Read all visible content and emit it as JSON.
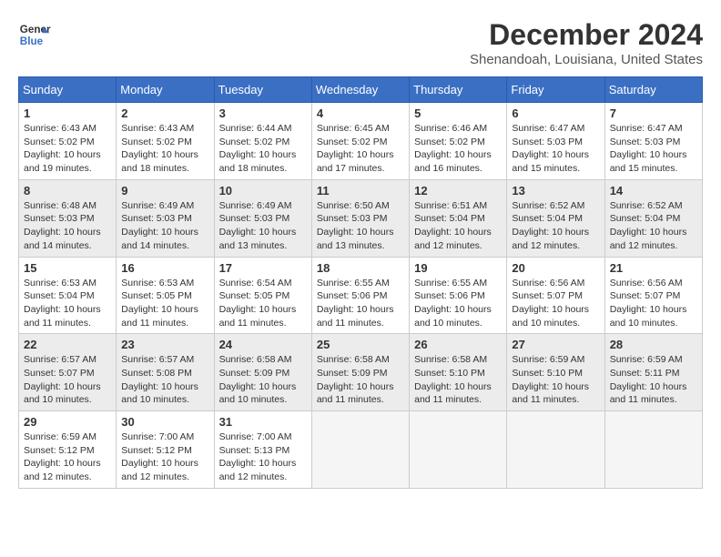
{
  "header": {
    "logo_line1": "General",
    "logo_line2": "Blue",
    "month": "December 2024",
    "location": "Shenandoah, Louisiana, United States"
  },
  "weekdays": [
    "Sunday",
    "Monday",
    "Tuesday",
    "Wednesday",
    "Thursday",
    "Friday",
    "Saturday"
  ],
  "weeks": [
    [
      {
        "day": "1",
        "sunrise": "6:43 AM",
        "sunset": "5:02 PM",
        "daylight": "10 hours and 19 minutes."
      },
      {
        "day": "2",
        "sunrise": "6:43 AM",
        "sunset": "5:02 PM",
        "daylight": "10 hours and 18 minutes."
      },
      {
        "day": "3",
        "sunrise": "6:44 AM",
        "sunset": "5:02 PM",
        "daylight": "10 hours and 18 minutes."
      },
      {
        "day": "4",
        "sunrise": "6:45 AM",
        "sunset": "5:02 PM",
        "daylight": "10 hours and 17 minutes."
      },
      {
        "day": "5",
        "sunrise": "6:46 AM",
        "sunset": "5:02 PM",
        "daylight": "10 hours and 16 minutes."
      },
      {
        "day": "6",
        "sunrise": "6:47 AM",
        "sunset": "5:03 PM",
        "daylight": "10 hours and 15 minutes."
      },
      {
        "day": "7",
        "sunrise": "6:47 AM",
        "sunset": "5:03 PM",
        "daylight": "10 hours and 15 minutes."
      }
    ],
    [
      {
        "day": "8",
        "sunrise": "6:48 AM",
        "sunset": "5:03 PM",
        "daylight": "10 hours and 14 minutes."
      },
      {
        "day": "9",
        "sunrise": "6:49 AM",
        "sunset": "5:03 PM",
        "daylight": "10 hours and 14 minutes."
      },
      {
        "day": "10",
        "sunrise": "6:49 AM",
        "sunset": "5:03 PM",
        "daylight": "10 hours and 13 minutes."
      },
      {
        "day": "11",
        "sunrise": "6:50 AM",
        "sunset": "5:03 PM",
        "daylight": "10 hours and 13 minutes."
      },
      {
        "day": "12",
        "sunrise": "6:51 AM",
        "sunset": "5:04 PM",
        "daylight": "10 hours and 12 minutes."
      },
      {
        "day": "13",
        "sunrise": "6:52 AM",
        "sunset": "5:04 PM",
        "daylight": "10 hours and 12 minutes."
      },
      {
        "day": "14",
        "sunrise": "6:52 AM",
        "sunset": "5:04 PM",
        "daylight": "10 hours and 12 minutes."
      }
    ],
    [
      {
        "day": "15",
        "sunrise": "6:53 AM",
        "sunset": "5:04 PM",
        "daylight": "10 hours and 11 minutes."
      },
      {
        "day": "16",
        "sunrise": "6:53 AM",
        "sunset": "5:05 PM",
        "daylight": "10 hours and 11 minutes."
      },
      {
        "day": "17",
        "sunrise": "6:54 AM",
        "sunset": "5:05 PM",
        "daylight": "10 hours and 11 minutes."
      },
      {
        "day": "18",
        "sunrise": "6:55 AM",
        "sunset": "5:06 PM",
        "daylight": "10 hours and 11 minutes."
      },
      {
        "day": "19",
        "sunrise": "6:55 AM",
        "sunset": "5:06 PM",
        "daylight": "10 hours and 10 minutes."
      },
      {
        "day": "20",
        "sunrise": "6:56 AM",
        "sunset": "5:07 PM",
        "daylight": "10 hours and 10 minutes."
      },
      {
        "day": "21",
        "sunrise": "6:56 AM",
        "sunset": "5:07 PM",
        "daylight": "10 hours and 10 minutes."
      }
    ],
    [
      {
        "day": "22",
        "sunrise": "6:57 AM",
        "sunset": "5:07 PM",
        "daylight": "10 hours and 10 minutes."
      },
      {
        "day": "23",
        "sunrise": "6:57 AM",
        "sunset": "5:08 PM",
        "daylight": "10 hours and 10 minutes."
      },
      {
        "day": "24",
        "sunrise": "6:58 AM",
        "sunset": "5:09 PM",
        "daylight": "10 hours and 10 minutes."
      },
      {
        "day": "25",
        "sunrise": "6:58 AM",
        "sunset": "5:09 PM",
        "daylight": "10 hours and 11 minutes."
      },
      {
        "day": "26",
        "sunrise": "6:58 AM",
        "sunset": "5:10 PM",
        "daylight": "10 hours and 11 minutes."
      },
      {
        "day": "27",
        "sunrise": "6:59 AM",
        "sunset": "5:10 PM",
        "daylight": "10 hours and 11 minutes."
      },
      {
        "day": "28",
        "sunrise": "6:59 AM",
        "sunset": "5:11 PM",
        "daylight": "10 hours and 11 minutes."
      }
    ],
    [
      {
        "day": "29",
        "sunrise": "6:59 AM",
        "sunset": "5:12 PM",
        "daylight": "10 hours and 12 minutes."
      },
      {
        "day": "30",
        "sunrise": "7:00 AM",
        "sunset": "5:12 PM",
        "daylight": "10 hours and 12 minutes."
      },
      {
        "day": "31",
        "sunrise": "7:00 AM",
        "sunset": "5:13 PM",
        "daylight": "10 hours and 12 minutes."
      },
      null,
      null,
      null,
      null
    ]
  ],
  "labels": {
    "sunrise": "Sunrise:",
    "sunset": "Sunset:",
    "daylight": "Daylight:"
  }
}
